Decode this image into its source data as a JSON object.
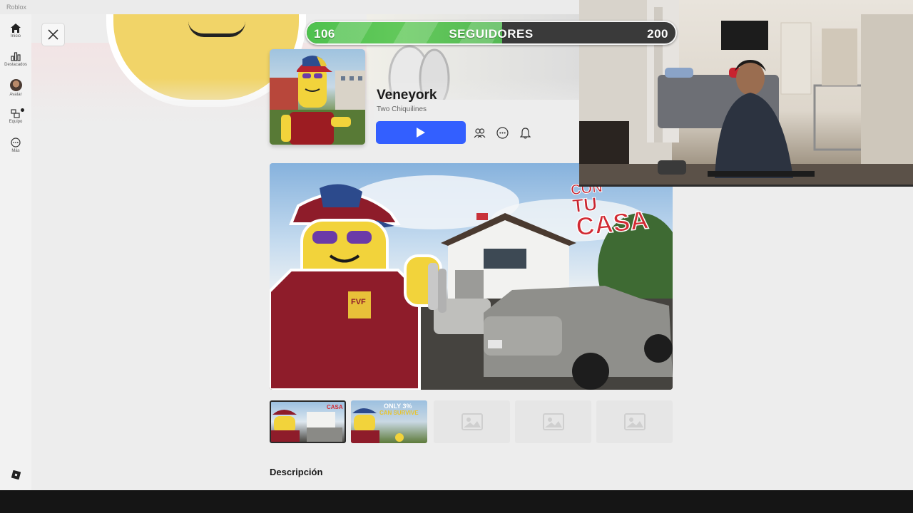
{
  "window": {
    "title": "Roblox"
  },
  "sidebar": {
    "items": [
      {
        "label": "Inicio",
        "icon": "home-icon"
      },
      {
        "label": "Destacados",
        "icon": "chart-icon"
      },
      {
        "label": "Avatar",
        "icon": "avatar-icon"
      },
      {
        "label": "Equipo",
        "icon": "team-icon"
      },
      {
        "label": "Más",
        "icon": "more-icon"
      }
    ],
    "logo": "roblox-logo-icon"
  },
  "game": {
    "title": "Veneyork",
    "creator": "Two Chiquilines",
    "actions": [
      "group-icon",
      "more-options-icon",
      "bell-icon"
    ]
  },
  "hero": {
    "overlay_text_1": "CON",
    "overlay_text_2": "TU",
    "overlay_text_3": "CASA",
    "shirt_text": "FVF"
  },
  "thumbnails": [
    {
      "type": "image",
      "badge": "CASA"
    },
    {
      "type": "image",
      "caption_1": "ONLY 3%",
      "caption_2": "CAN SURVIVE"
    },
    {
      "type": "placeholder"
    },
    {
      "type": "placeholder"
    },
    {
      "type": "placeholder"
    }
  ],
  "description": {
    "heading": "Descripción"
  },
  "followers_goal": {
    "current": "106",
    "label": "SEGUIDORES",
    "target": "200",
    "progress": 0.53,
    "fill_color": "#55b955"
  },
  "colors": {
    "play_button": "#335fff",
    "background": "#ededed"
  }
}
